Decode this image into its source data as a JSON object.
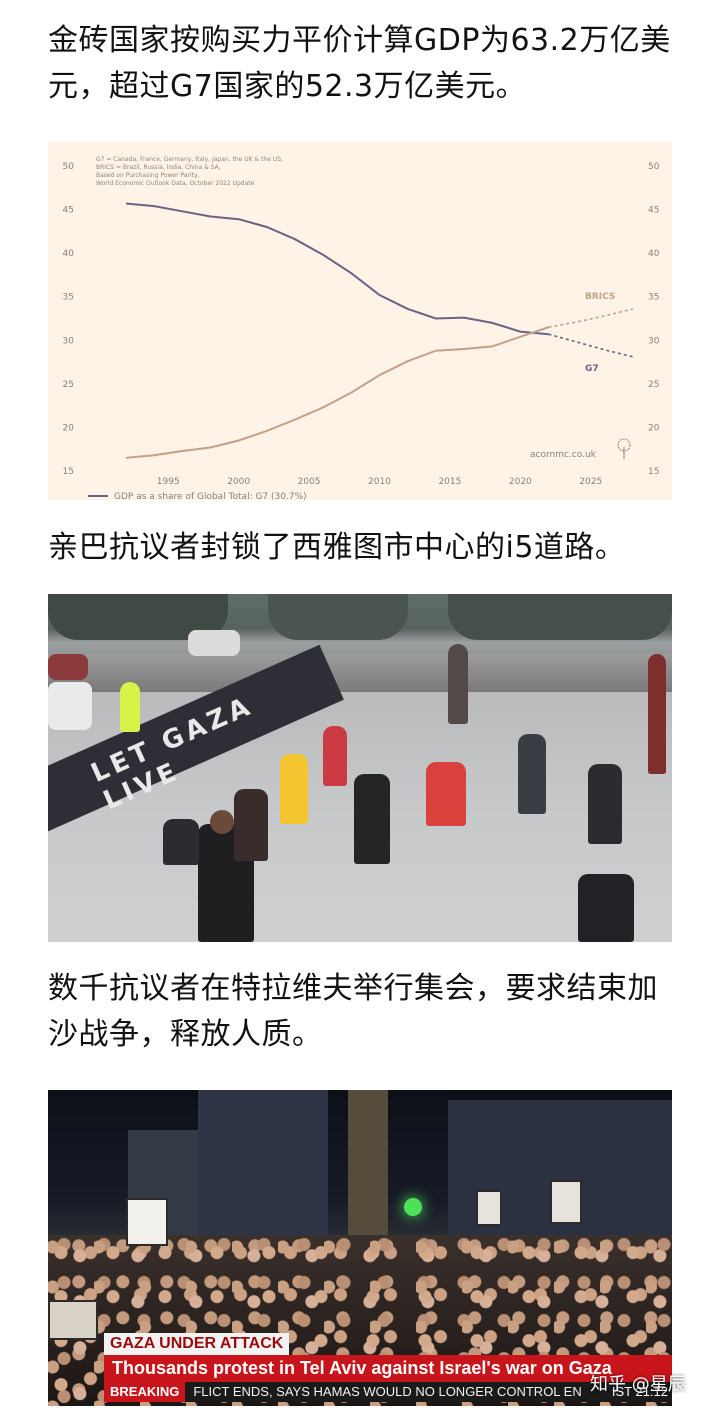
{
  "paragraphs": {
    "p1": "金砖国家按购买力平价计算GDP为63.2万亿美元，超过G7国家的52.3万亿美元。",
    "p2": "亲巴抗议者封锁了西雅图市中心的i5道路。",
    "p3": "数千抗议者在特拉维夫举行集会，要求结束加沙战争，释放人质。"
  },
  "chart": {
    "notes": [
      "G7 = Canada, France, Germany, Italy, Japan, the UK & the US,",
      "BRICS = Brazil, Russia, India, China & SA,",
      "Based on Purchasing Power Parity,",
      "World Economic Outlook Data, October 2022 Update"
    ],
    "source": "acornmc.co.uk",
    "legend_text": "GDP as a share of Global Total: G7 (30.7%)",
    "colors": {
      "background": "#fdf3e6",
      "g7": "#6b6286",
      "brics": "#c4a088",
      "axis_text": "#8a8076"
    }
  },
  "chart_data": {
    "type": "line",
    "x_ticks": [
      1995,
      2000,
      2005,
      2010,
      2015,
      2020,
      2025
    ],
    "y_ticks": [
      15,
      20,
      25,
      30,
      35,
      40,
      45,
      50
    ],
    "xlim": [
      1992,
      2028
    ],
    "ylim": [
      15,
      50
    ],
    "grid": false,
    "series": [
      {
        "name": "G7",
        "projected_from": 2022,
        "x": [
          1992,
          1994,
          1996,
          1998,
          2000,
          2002,
          2004,
          2006,
          2008,
          2010,
          2012,
          2014,
          2016,
          2018,
          2020,
          2022,
          2024,
          2026,
          2028
        ],
        "y": [
          45.7,
          45.4,
          44.8,
          44.2,
          43.9,
          43.0,
          41.6,
          39.8,
          37.7,
          35.2,
          33.6,
          32.5,
          32.6,
          32.0,
          31.0,
          30.7,
          29.8,
          28.9,
          28.1
        ]
      },
      {
        "name": "BRICS",
        "projected_from": 2022,
        "x": [
          1992,
          1994,
          1996,
          1998,
          2000,
          2002,
          2004,
          2006,
          2008,
          2010,
          2012,
          2014,
          2016,
          2018,
          2020,
          2022,
          2024,
          2026,
          2028
        ],
        "y": [
          16.5,
          16.8,
          17.3,
          17.7,
          18.5,
          19.6,
          20.9,
          22.3,
          24.0,
          26.0,
          27.6,
          28.8,
          29.0,
          29.3,
          30.4,
          31.5,
          32.1,
          32.8,
          33.6
        ]
      }
    ]
  },
  "photo1": {
    "banner_text": "LET GAZA LIVE"
  },
  "photo2": {
    "tag": "GAZA UNDER ATTACK",
    "headline": "Thousands protest in Tel Aviv against Israel's war on Gaza",
    "breaking": "BREAKING",
    "ticker": "FLICT ENDS, SAYS HAMAS WOULD NO LONGER CONTROL EN",
    "clock": "IST 21:12"
  },
  "watermark": "知乎 @星辰"
}
